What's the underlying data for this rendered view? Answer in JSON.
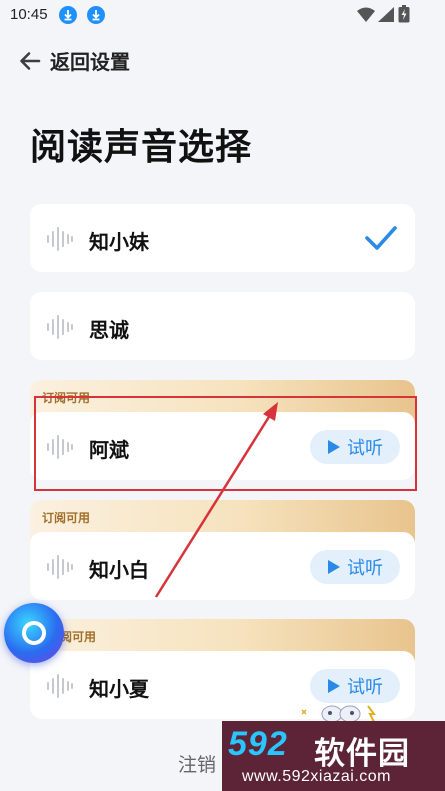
{
  "status_bar": {
    "time": "10:45"
  },
  "header": {
    "back_label": "返回设置"
  },
  "page_title": "阅读声音选择",
  "voices": [
    {
      "name": "知小妹",
      "selected": true
    },
    {
      "name": "思诚"
    }
  ],
  "subscription_voices": [
    {
      "badge": "订阅可用",
      "name": "阿斌",
      "try_label": "试听"
    },
    {
      "badge": "订阅可用",
      "name": "知小白",
      "try_label": "试听"
    },
    {
      "badge": "阅可用",
      "name": "知小夏",
      "try_label": "试听"
    }
  ],
  "logout_label": "注销",
  "watermark": {
    "brand_num": "592",
    "brand_cn": "软件园",
    "url": "www.592xiazai.com"
  },
  "colors": {
    "accent": "#2a8ae6",
    "annotation": "#d8323a",
    "sub_badge": "#a06f2b"
  },
  "icons": [
    "download-icon",
    "wifi-icon",
    "signal-icon",
    "battery-icon",
    "back-arrow-icon",
    "sound-wave-icon",
    "check-icon",
    "play-icon"
  ]
}
